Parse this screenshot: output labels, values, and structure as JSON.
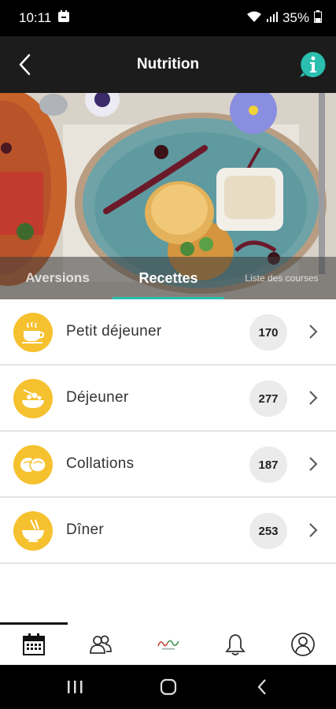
{
  "status": {
    "time": "10:11",
    "battery": "35%"
  },
  "header": {
    "title": "Nutrition"
  },
  "tabs": [
    {
      "label": "Aversions"
    },
    {
      "label": "Recettes"
    },
    {
      "label": "Liste des courses"
    }
  ],
  "categories": [
    {
      "label": "Petit déjeuner",
      "count": "170",
      "icon": "coffee-cup-icon"
    },
    {
      "label": "Déjeuner",
      "count": "277",
      "icon": "lunch-bowl-icon"
    },
    {
      "label": "Collations",
      "count": "187",
      "icon": "snack-icon"
    },
    {
      "label": "Dîner",
      "count": "253",
      "icon": "dinner-bowl-icon"
    }
  ],
  "colors": {
    "accent": "#2bbfb0",
    "category_icon_bg": "#f6c12e",
    "header_bg": "#1c1c1c"
  },
  "bottom_nav": [
    {
      "icon": "calendar-icon"
    },
    {
      "icon": "community-icon"
    },
    {
      "icon": "logo-icon"
    },
    {
      "icon": "bell-icon"
    },
    {
      "icon": "profile-icon"
    }
  ]
}
